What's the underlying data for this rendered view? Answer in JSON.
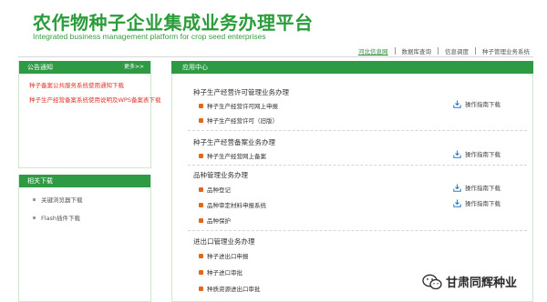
{
  "header": {
    "title": "农作物种子企业集成业务办理平台",
    "subtitle": "Integrated business management platform for crop seed enterprises"
  },
  "topnav": {
    "items": [
      "河北信息网",
      "数据库查询",
      "信息调度",
      "种子管理业务系统"
    ],
    "active_index": 0
  },
  "notice_panel": {
    "title": "公告通知",
    "more": "更多>>",
    "items": [
      "种子备案公共服务系统使用通知下载",
      "种子生产经营备案系统使用说明及WPS备案表下载"
    ]
  },
  "downloads_panel": {
    "title": "相关下载",
    "items": [
      "关键浏览器下载",
      "Flash插件下载"
    ]
  },
  "main": {
    "title": "应用中心",
    "sections": [
      {
        "title": "种子生产经营许可管理业务办理",
        "items": [
          "种子生产经营许可网上申报",
          "种子生产经营许可（旧版）"
        ],
        "guide": "操作指南下载"
      },
      {
        "title": "种子生产经营备案业务办理",
        "items": [
          "种子生产经营网上备案"
        ],
        "guide": "操作指南下载"
      },
      {
        "title": "品种管理业务办理",
        "items": [
          "品种登记",
          "品种审定材料申报系统",
          "品种保护"
        ],
        "guides": [
          "操作指南下载",
          "操作指南下载"
        ]
      },
      {
        "title": "进出口管理业务办理",
        "items": [
          "种子进出口申报",
          "种子进口审批",
          "种质资源进出口审批"
        ]
      }
    ]
  },
  "watermark": {
    "text": "甘肃同辉种业"
  },
  "colors": {
    "brand_green": "#2e9a43",
    "bullet_orange": "#e06a1a",
    "notice_red": "#e0352b",
    "guide_blue": "#2a78c2"
  }
}
